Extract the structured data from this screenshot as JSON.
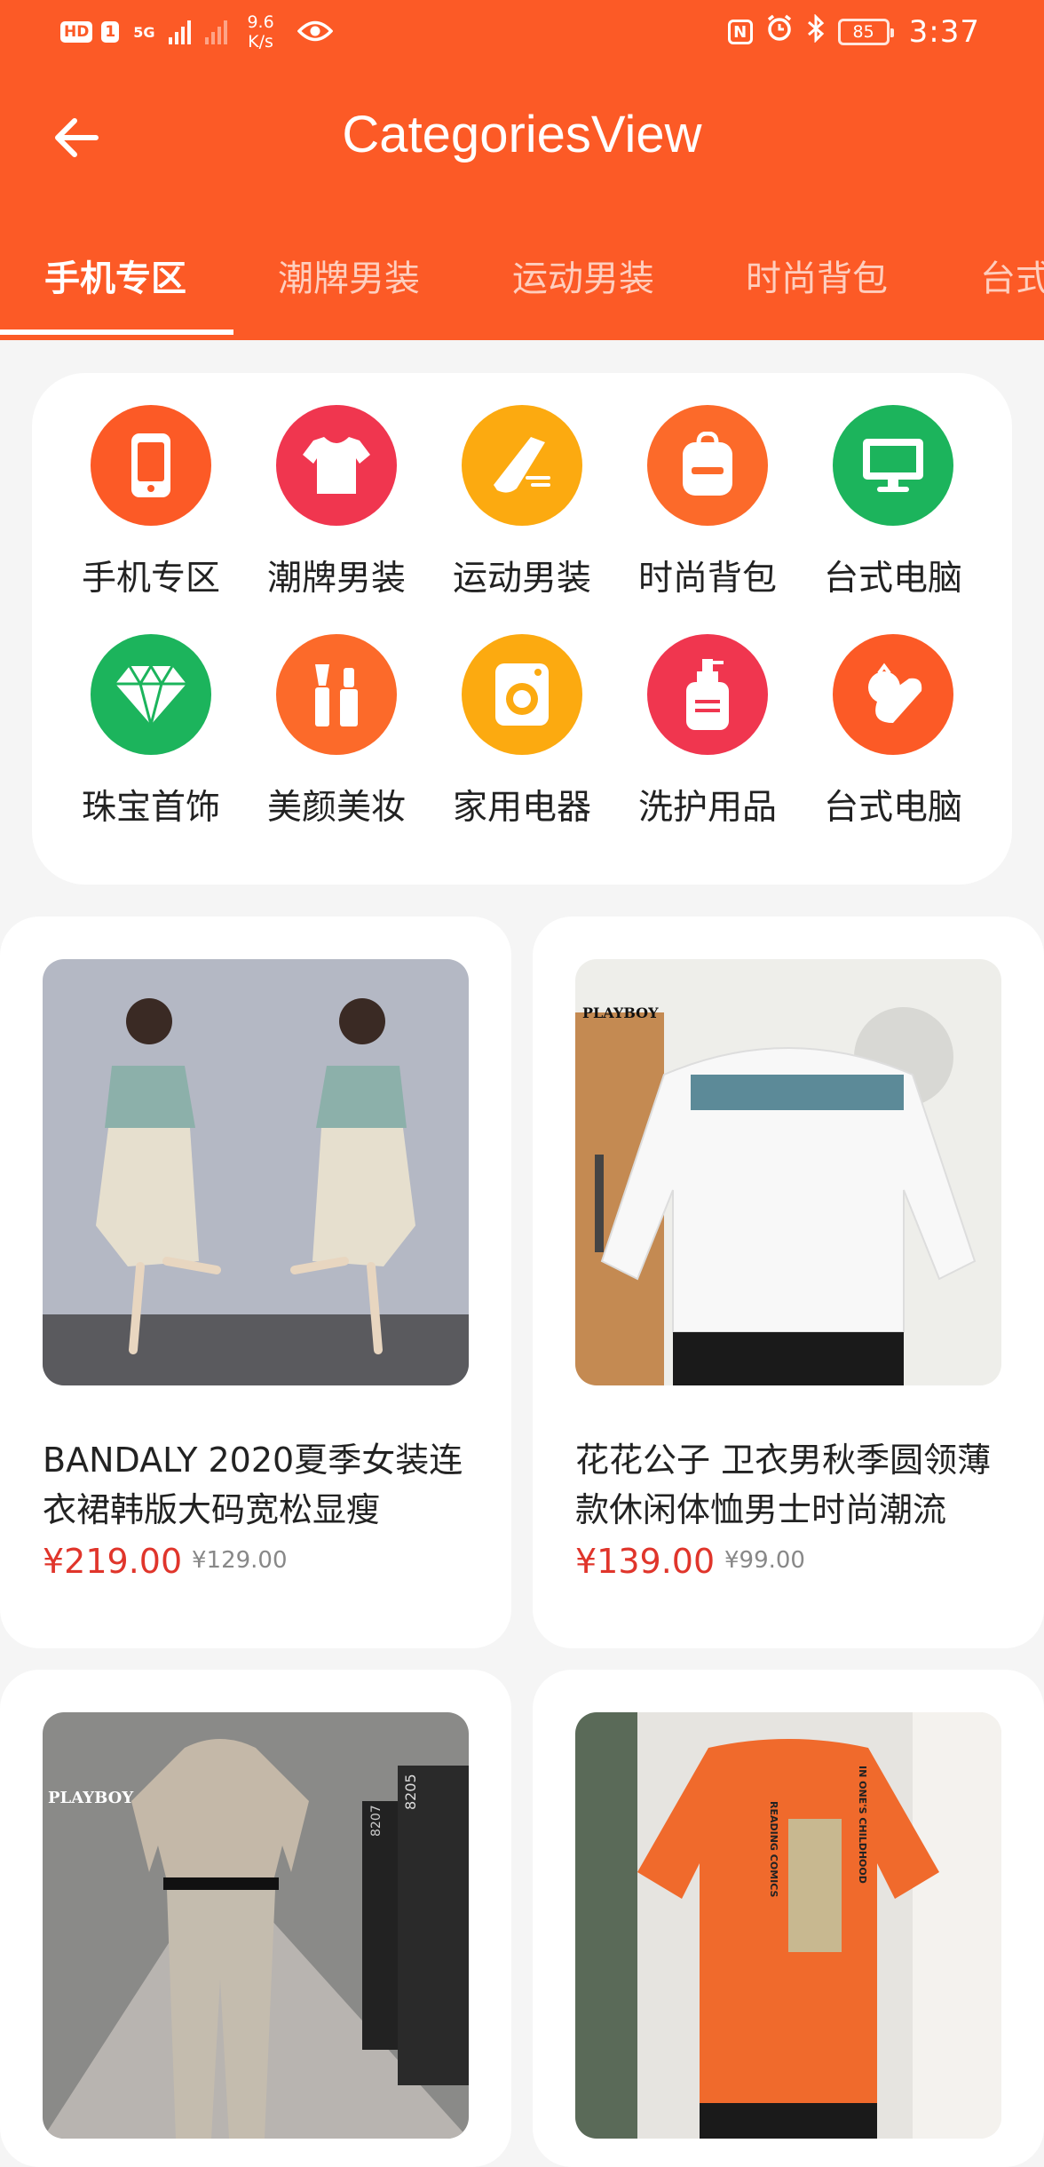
{
  "status_bar": {
    "badges": [
      "HD",
      "1"
    ],
    "network": "5G",
    "speed_value": "9.6",
    "speed_unit": "K/s",
    "nfc": "N",
    "battery": "85",
    "time": "3:37"
  },
  "header": {
    "title": "CategoriesView",
    "back_icon": "arrow-left-icon",
    "background_color": "#fc5a26"
  },
  "tabs": [
    {
      "label": "手机专区",
      "active": true
    },
    {
      "label": "潮牌男装",
      "active": false
    },
    {
      "label": "运动男装",
      "active": false
    },
    {
      "label": "时尚背包",
      "active": false
    },
    {
      "label": "台式",
      "active": false
    }
  ],
  "categories": [
    {
      "label": "手机专区",
      "icon": "phone-icon",
      "color": "#fc5a26"
    },
    {
      "label": "潮牌男装",
      "icon": "tshirt-icon",
      "color": "#f0364f"
    },
    {
      "label": "运动男装",
      "icon": "sneaker-icon",
      "color": "#fcaa10"
    },
    {
      "label": "时尚背包",
      "icon": "backpack-icon",
      "color": "#fc6a2a"
    },
    {
      "label": "台式电脑",
      "icon": "monitor-icon",
      "color": "#1cb45c"
    },
    {
      "label": "珠宝首饰",
      "icon": "diamond-icon",
      "color": "#1cb45c"
    },
    {
      "label": "美颜美妆",
      "icon": "cosmetics-icon",
      "color": "#fc6a2a"
    },
    {
      "label": "家用电器",
      "icon": "washing-machine-icon",
      "color": "#fcaa10"
    },
    {
      "label": "洗护用品",
      "icon": "lotion-bottle-icon",
      "color": "#f0364f"
    },
    {
      "label": "台式电脑",
      "icon": "vegetables-icon",
      "color": "#fc5a26"
    }
  ],
  "products": [
    {
      "title": "BANDALY 2020夏季女装连衣裙韩版大码宽松显瘦",
      "price": "¥219.00",
      "original_price": "¥129.00",
      "image": "product-photo-woman-dress"
    },
    {
      "title": "花花公子 卫衣男秋季圆领薄款休闲体恤男士时尚潮流",
      "price": "¥139.00",
      "original_price": "¥99.00",
      "image": "product-photo-men-sweatshirt"
    },
    {
      "title": "",
      "price": "",
      "original_price": "",
      "image": "product-photo-men-tshirt-set"
    },
    {
      "title": "",
      "price": "",
      "original_price": "",
      "image": "product-photo-orange-tshirt"
    }
  ],
  "image_text": {
    "brand": "PLAYBOY",
    "room_numbers": [
      "8207",
      "8205"
    ],
    "tee_text_1": "IN ONE'S CHILDHOOD",
    "tee_text_2": "READING COMICS"
  },
  "colors": {
    "accent": "#fc5a26",
    "price": "#e0352b",
    "background": "#f5f5f5"
  }
}
